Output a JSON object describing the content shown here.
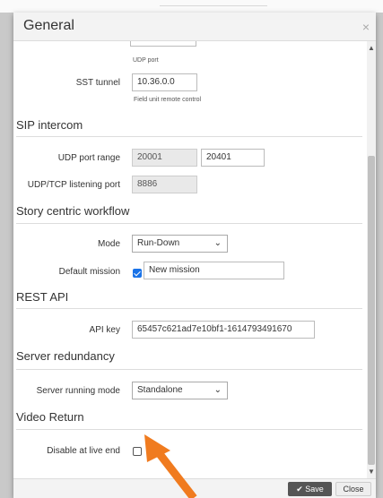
{
  "dialog": {
    "title": "General",
    "close_glyph": "×"
  },
  "sst": {
    "udp_help": "UDP port",
    "tunnel_label": "SST tunnel",
    "tunnel_value": "10.36.0.0",
    "tunnel_help": "Field unit remote control"
  },
  "sip": {
    "heading": "SIP intercom",
    "range_label": "UDP port range",
    "range_from": "20001",
    "range_to": "20401",
    "listen_label": "UDP/TCP listening port",
    "listen_value": "8886"
  },
  "story": {
    "heading": "Story centric workflow",
    "mode_label": "Mode",
    "mode_value": "Run-Down",
    "mission_label": "Default mission",
    "mission_checked": true,
    "mission_value": "New mission"
  },
  "rest": {
    "heading": "REST API",
    "key_label": "API key",
    "key_value": "65457c621ad7e10bf1-1614793491670"
  },
  "redundancy": {
    "heading": "Server redundancy",
    "mode_label": "Server running mode",
    "mode_value": "Standalone"
  },
  "video": {
    "heading": "Video Return",
    "disable_label": "Disable at live end",
    "disable_checked": false
  },
  "footer": {
    "save_label": "Save",
    "save_icon": "✔",
    "close_label": "Close"
  },
  "icons": {
    "chevron": "⌄",
    "scroll_up": "▲",
    "scroll_down": "▼"
  },
  "colors": {
    "arrow": "#f07b1f",
    "checkbox": "#1a73e8",
    "save_button": "#555555"
  }
}
